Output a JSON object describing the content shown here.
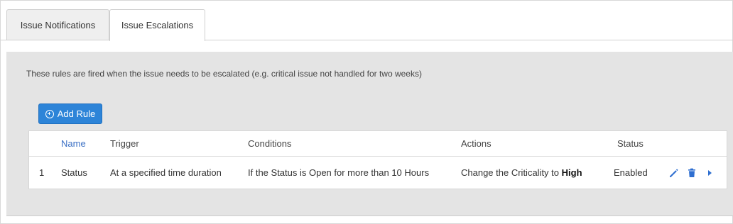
{
  "tabs": [
    {
      "label": "Issue Notifications",
      "active": false
    },
    {
      "label": "Issue Escalations",
      "active": true
    }
  ],
  "panel": {
    "description": "These rules are fired when the issue needs to be escalated (e.g. critical issue not handled for two weeks)",
    "add_button": {
      "label": "Add Rule",
      "icon": "plus-circle-icon"
    }
  },
  "table": {
    "columns": [
      "Name",
      "Trigger",
      "Conditions",
      "Actions",
      "Status"
    ],
    "rows": [
      {
        "index": "1",
        "name": "Status",
        "trigger": "At a specified time duration",
        "conditions": "If the Status is Open for more than 10 Hours",
        "actions_prefix": "Change the Criticality to",
        "actions_value": "High",
        "status": "Enabled",
        "row_icons": [
          "edit-icon",
          "delete-icon",
          "expand-arrow-icon"
        ]
      }
    ]
  },
  "colors": {
    "accent": "#2d84d8",
    "icon_blue": "#2f6fd0",
    "name_header": "#3a6fc4",
    "panel_bg": "#e4e4e4"
  }
}
